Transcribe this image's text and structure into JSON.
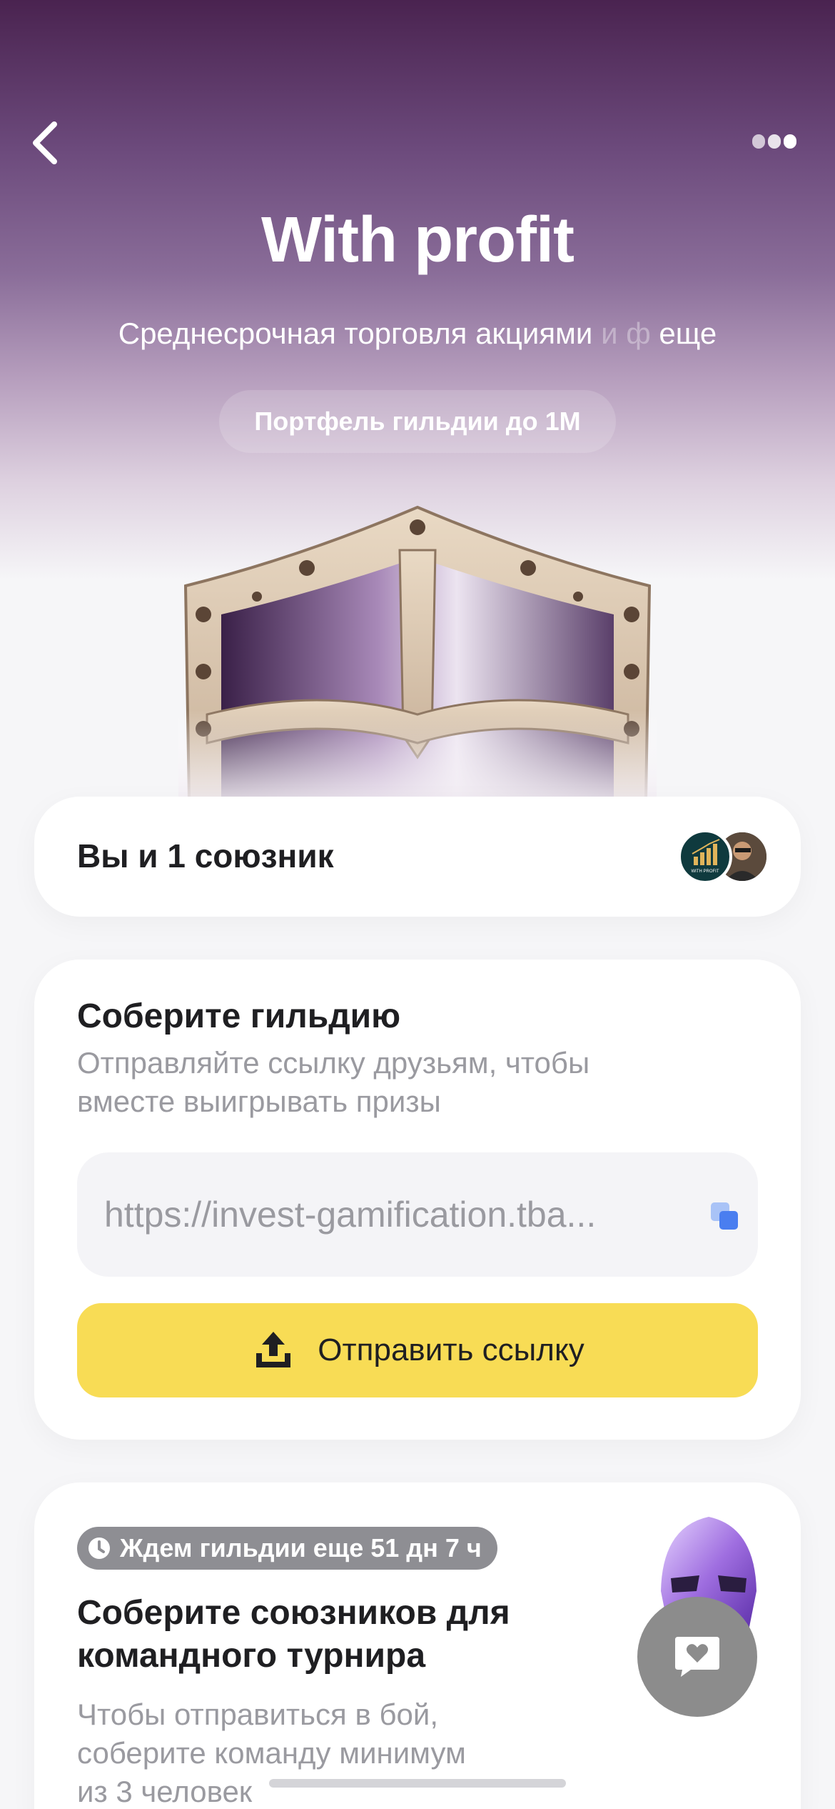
{
  "header": {
    "title": "With profit",
    "subtitle_main": "Среднесрочная торговля акциями",
    "subtitle_faded": " и ф",
    "subtitle_end": "  еще",
    "chip": "Портфель гильдии до 1М"
  },
  "icons": {
    "back": "chevron-left-icon",
    "more": "more-dots-icon",
    "copy": "copy-icon",
    "share": "share-upload-icon",
    "clock": "clock-icon",
    "chat": "chat-heart-icon"
  },
  "allies": {
    "label": "Вы и 1 союзник",
    "avatar1_caption": "WITH PROFIT"
  },
  "guild": {
    "title": "Соберите гильдию",
    "desc_line1": "Отправляйте ссылку друзьям, чтобы",
    "desc_line2": "вместе выигрывать призы",
    "link": "https://invest-gamification.tba...",
    "send_label": "Отправить ссылку"
  },
  "tournament": {
    "timer": "Ждем гильдии еще 51 дн 7 ч",
    "title_line1": "Соберите союзников для",
    "title_line2": "командного турнира",
    "desc_line1": "Чтобы отправиться в бой,",
    "desc_line2": "соберите команду минимум",
    "desc_line3": "из 3 человек"
  },
  "colors": {
    "accent_yellow": "#f8dc55",
    "hero_purple": "#4a2350",
    "copy_blue": "#4a7ef0"
  }
}
